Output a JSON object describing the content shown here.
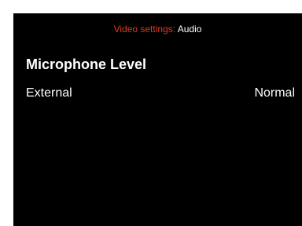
{
  "header": {
    "prefix": "Video settings:",
    "page": "Audio"
  },
  "section": {
    "title": "Microphone Level"
  },
  "settings": [
    {
      "label": "External",
      "value": "Normal"
    }
  ],
  "colors": {
    "background": "#000000",
    "text": "#ffffff",
    "accent": "#e03a1e"
  }
}
